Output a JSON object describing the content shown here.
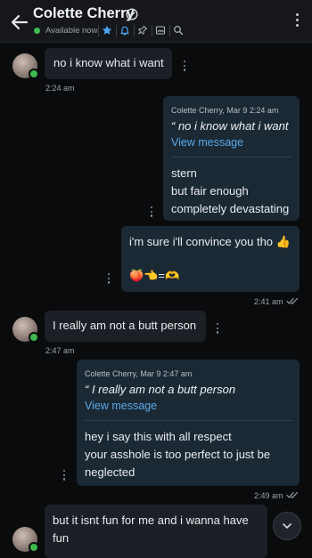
{
  "header": {
    "title": "Colette Cherry",
    "status": "Available now"
  },
  "messages": [
    {
      "text": "no i know what i want",
      "time": "2:24 am"
    },
    {
      "quote_author": "Colette Cherry, Mar 9 2:24 am",
      "quote_text": "“ no i know what i want",
      "view": "View message",
      "lines": [
        "stern",
        "but fair enough",
        "completely devastating"
      ]
    },
    {
      "lines": [
        "i'm sure i'll convince you tho 👍",
        "🍑👈=🫶"
      ],
      "time": "2:41 am"
    },
    {
      "text": "I really am not a butt person",
      "time": "2:47 am"
    },
    {
      "quote_author": "Colette Cherry, Mar 9 2:47 am",
      "quote_text": "“ I really am not a butt person",
      "view": "View message",
      "lines": [
        "hey i say this with all respect",
        "your asshole is too perfect to just be",
        "neglected"
      ],
      "time": "2:49 am"
    },
    {
      "lines": [
        "but it isnt fun for me and i wanna have",
        "fun"
      ]
    }
  ]
}
